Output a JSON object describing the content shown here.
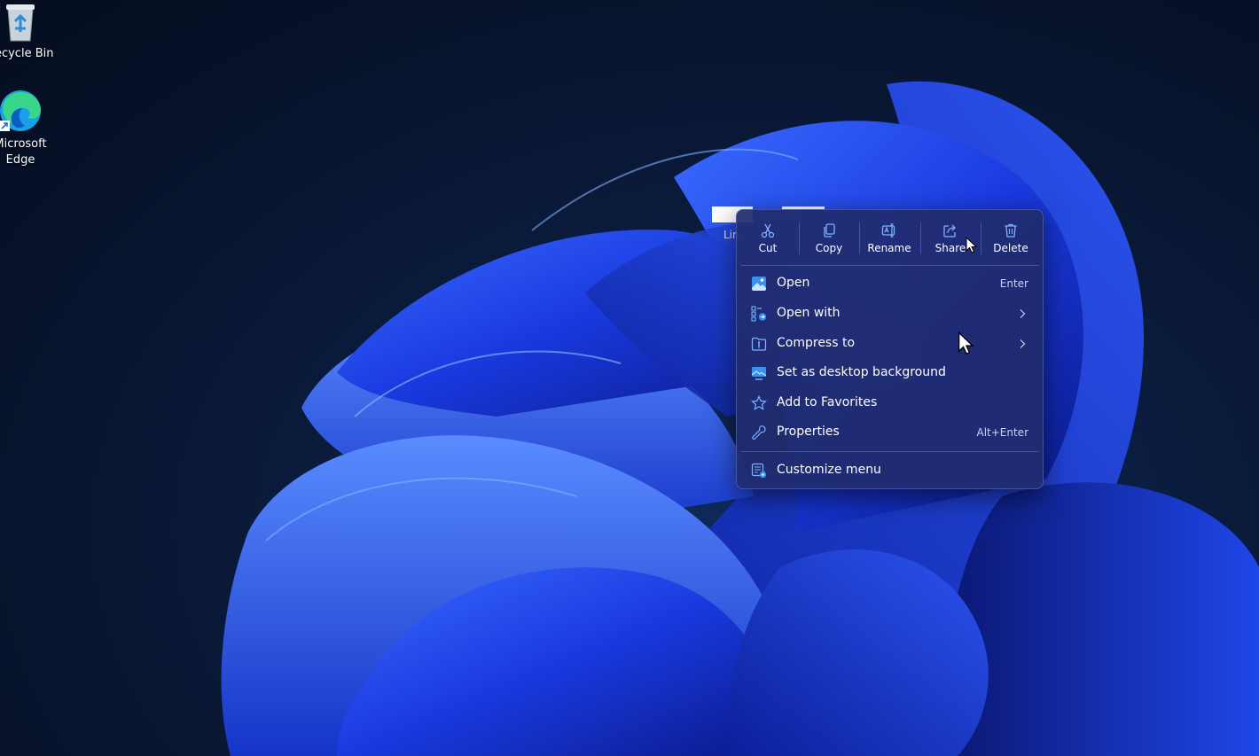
{
  "desktop": {
    "icons": [
      {
        "label": "Recycle Bin",
        "icon": "recycle-bin-icon"
      },
      {
        "label_line1": "Microsoft",
        "label_line2": "Edge",
        "icon": "edge-icon"
      }
    ],
    "selected_file_label": "Lin"
  },
  "context_menu": {
    "quick_actions": [
      {
        "label": "Cut",
        "icon": "scissors-icon"
      },
      {
        "label": "Copy",
        "icon": "copy-icon"
      },
      {
        "label": "Rename",
        "icon": "rename-icon"
      },
      {
        "label": "Share",
        "icon": "share-icon"
      },
      {
        "label": "Delete",
        "icon": "trash-icon"
      }
    ],
    "items": [
      {
        "label": "Open",
        "shortcut": "Enter",
        "icon": "image-icon"
      },
      {
        "label": "Open with",
        "icon": "open-with-icon",
        "submenu": true
      },
      {
        "label": "Compress to",
        "icon": "compress-icon",
        "submenu": true
      },
      {
        "label": "Set as desktop background",
        "icon": "desktop-background-icon"
      },
      {
        "label": "Add to Favorites",
        "icon": "star-icon"
      },
      {
        "label": "Properties",
        "shortcut": "Alt+Enter",
        "icon": "wrench-icon"
      }
    ],
    "footer_item": {
      "label": "Customize menu",
      "icon": "customize-icon"
    }
  },
  "colors": {
    "menu_background": "#202c6e",
    "icon_accent": "#7fb2ff",
    "desktop_background": "#07122a"
  }
}
